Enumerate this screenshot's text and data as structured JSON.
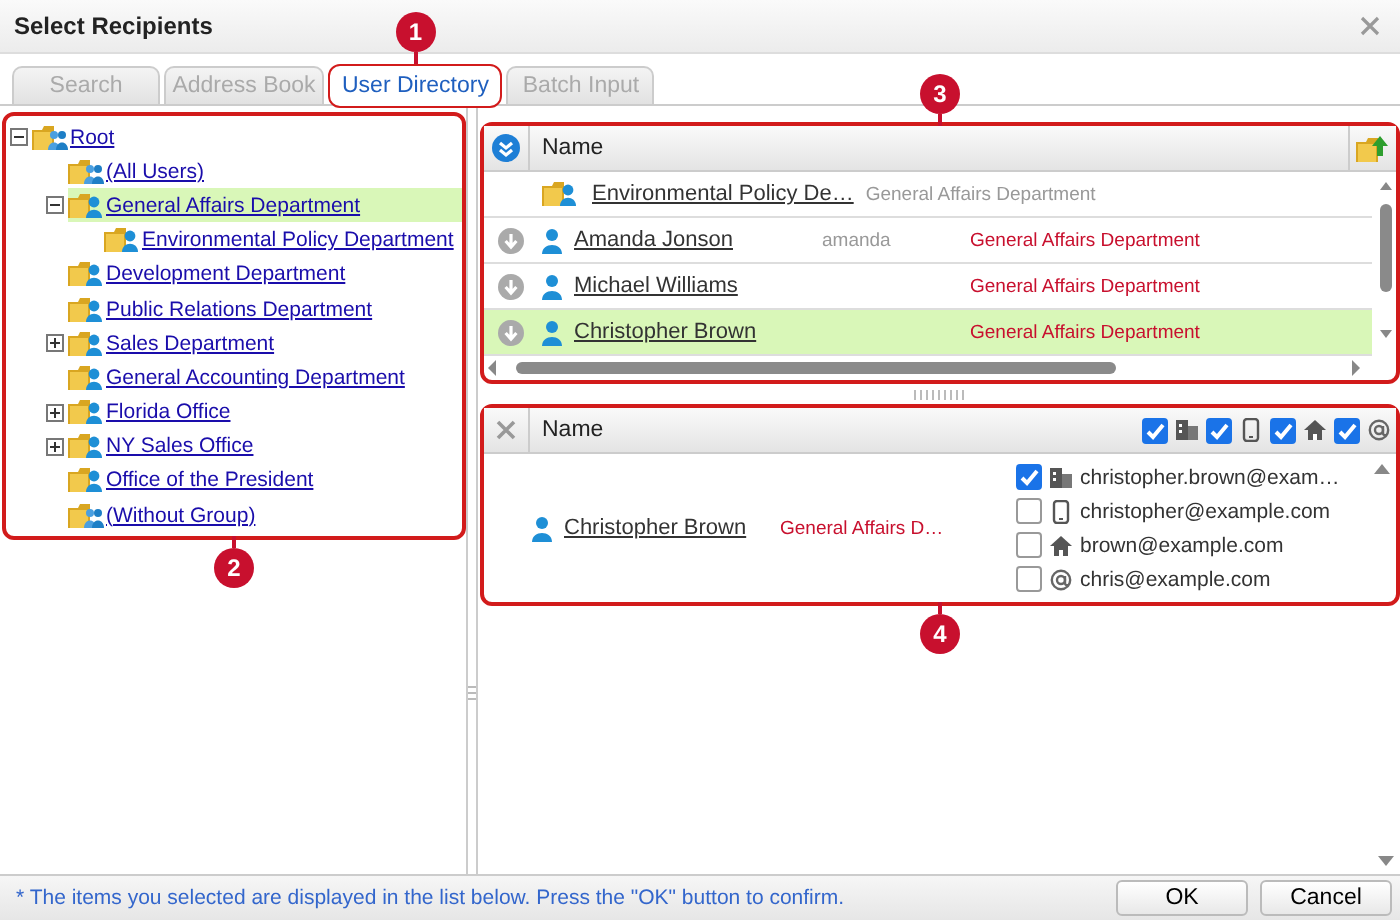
{
  "window": {
    "title": "Select Recipients"
  },
  "tabs": [
    {
      "label": "Search",
      "selected": false
    },
    {
      "label": "Address Book",
      "selected": false
    },
    {
      "label": "User Directory",
      "selected": true
    },
    {
      "label": "Batch Input",
      "selected": false
    }
  ],
  "tree": [
    {
      "label": "Root",
      "kind": "users",
      "selected": false,
      "expanded": true,
      "children": [
        {
          "label": "(All Users)",
          "kind": "users",
          "selected": false
        },
        {
          "label": "General Affairs Department",
          "kind": "group",
          "selected": true,
          "expanded": true,
          "children": [
            {
              "label": "Environmental Policy Department",
              "kind": "group",
              "selected": false
            }
          ]
        },
        {
          "label": "Development Department",
          "kind": "group",
          "selected": false
        },
        {
          "label": "Public Relations Department",
          "kind": "group",
          "selected": false
        },
        {
          "label": "Sales Department",
          "kind": "group",
          "selected": false,
          "expanded": false
        },
        {
          "label": "General Accounting Department",
          "kind": "group",
          "selected": false
        },
        {
          "label": "Florida Office",
          "kind": "group",
          "selected": false,
          "expanded": false
        },
        {
          "label": "NY Sales Office",
          "kind": "group",
          "selected": false,
          "expanded": false
        },
        {
          "label": "Office of the President",
          "kind": "group",
          "selected": false
        },
        {
          "label": "(Without Group)",
          "kind": "users",
          "selected": false
        }
      ]
    }
  ],
  "candidates": {
    "header": "Name",
    "rows": [
      {
        "kind": "group",
        "name": "Environmental Policy De…",
        "department": "General Affairs Department",
        "selected": false
      },
      {
        "kind": "user",
        "name": "Amanda Jonson",
        "login": "amanda",
        "department": "General Affairs Department",
        "selected": false
      },
      {
        "kind": "user",
        "name": "Michael Williams",
        "department": "General Affairs Department",
        "selected": false
      },
      {
        "kind": "user",
        "name": "Christopher Brown",
        "department": "General Affairs Department",
        "selected": true
      }
    ]
  },
  "recipients": {
    "header": "Name",
    "filters": [
      {
        "kind": "work",
        "checked": true
      },
      {
        "kind": "mobile",
        "checked": true
      },
      {
        "kind": "home",
        "checked": true
      },
      {
        "kind": "other",
        "checked": true
      }
    ],
    "rows": [
      {
        "name": "Christopher Brown",
        "department": "General Affairs D…",
        "addresses": [
          {
            "kind": "work",
            "address": "christopher.brown@exam…",
            "checked": true
          },
          {
            "kind": "mobile",
            "address": "christopher@example.com",
            "checked": false
          },
          {
            "kind": "home",
            "address": "brown@example.com",
            "checked": false
          },
          {
            "kind": "other",
            "address": "chris@example.com",
            "checked": false
          }
        ]
      }
    ]
  },
  "callouts": [
    "1",
    "2",
    "3",
    "4"
  ],
  "status_bar": {
    "note": "* The items you selected are displayed in the list below. Press the \"OK\" button to confirm.",
    "buttons": [
      "OK",
      "Cancel"
    ]
  }
}
